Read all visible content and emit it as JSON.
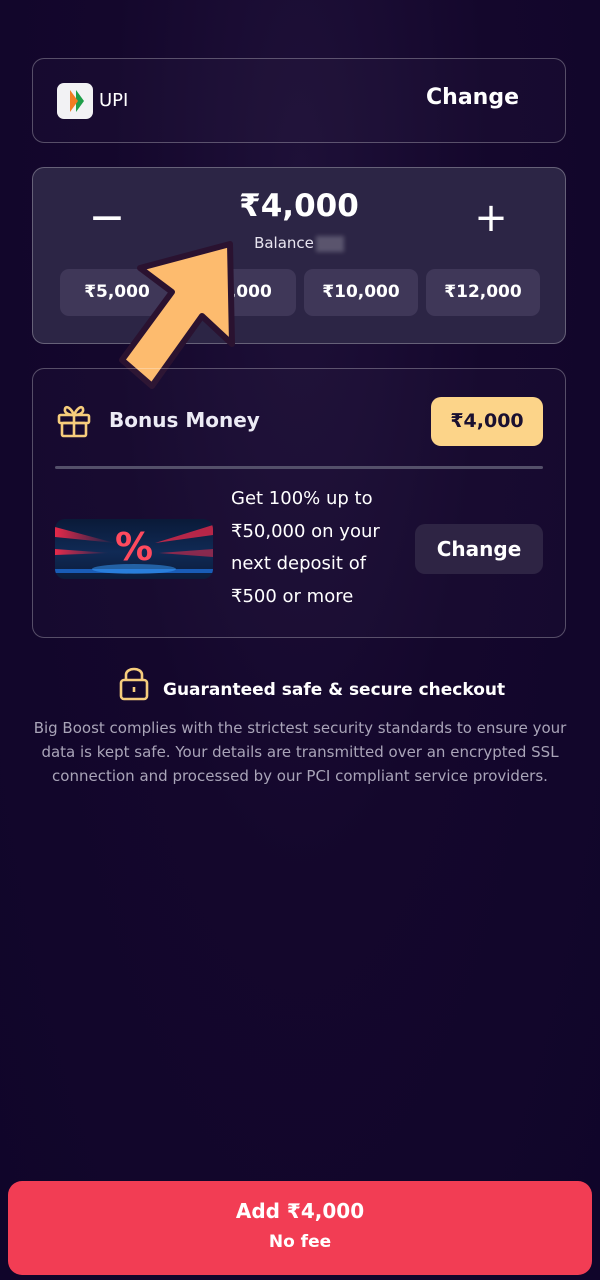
{
  "payment_method": {
    "label": "UPI",
    "change_label": "Change"
  },
  "amount": {
    "minus_symbol": "−",
    "plus_symbol": "+",
    "value": "₹4,000",
    "balance_label": "Balance",
    "presets": [
      "₹5,000",
      "₹8,000",
      "₹10,000",
      "₹12,000"
    ]
  },
  "bonus": {
    "title": "Bonus Money",
    "amount": "₹4,000",
    "promo_banner_symbol": "%",
    "promo_text": "Get 100% up to ₹50,000 on your next deposit of ₹500 or more",
    "change_label": "Change"
  },
  "security": {
    "title": "Guaranteed safe & secure checkout",
    "description": "Big Boost complies with the strictest security standards to ensure your data is kept safe. Your details are transmitted over an encrypted SSL connection and processed by our PCI compliant service providers."
  },
  "cta": {
    "title": "Add ₹4,000",
    "subtitle": "No fee"
  },
  "colors": {
    "background": "#14072c",
    "accent_red": "#f23d54",
    "bonus_badge": "#fcd489",
    "icon_gold": "#f6cd7c",
    "arrow_orange": "#fdbb6e"
  },
  "icons": {
    "payment": "upi-logo-icon",
    "gift": "gift-icon",
    "lock": "lock-icon",
    "overlay": "pointer-arrow-icon"
  }
}
